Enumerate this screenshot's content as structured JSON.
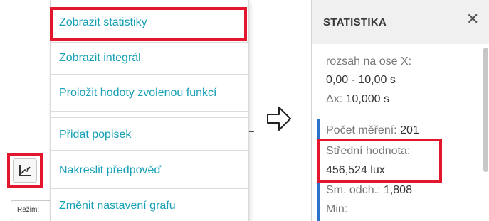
{
  "colors": {
    "accent": "#16a0b5",
    "highlight": "#e2172d",
    "marker": "#2a72c9"
  },
  "toolbar": {
    "graph_tool_icon": "chart-tool-icon",
    "mode_select_value": "Režim:"
  },
  "menu": {
    "items": [
      {
        "label": "Zobrazit statistiky"
      },
      {
        "label": "Zobrazit integrál"
      },
      {
        "label": "Proložit hodoty zvolenou funkcí"
      },
      {
        "label": "Přidat popisek"
      },
      {
        "label": "Nakreslit předpověď"
      },
      {
        "label": "Změnit nastavení grafu"
      }
    ]
  },
  "arrow_icon": "outline-arrow-right-icon",
  "panel": {
    "title": "STATISTIKA",
    "close_icon": "close-icon",
    "range_label": "rozsah na ose X:",
    "range_value": "0,00 - 10,00 s",
    "dx_label": "Δx:",
    "dx_value": "10,000 s",
    "count_label": "Počet měření:",
    "count_value": "201",
    "mean_label": "Střední hodnota:",
    "mean_value": "456,524 lux",
    "sd_label": "Sm. odch.:",
    "sd_value": "1,808",
    "min_label": "Min:"
  }
}
